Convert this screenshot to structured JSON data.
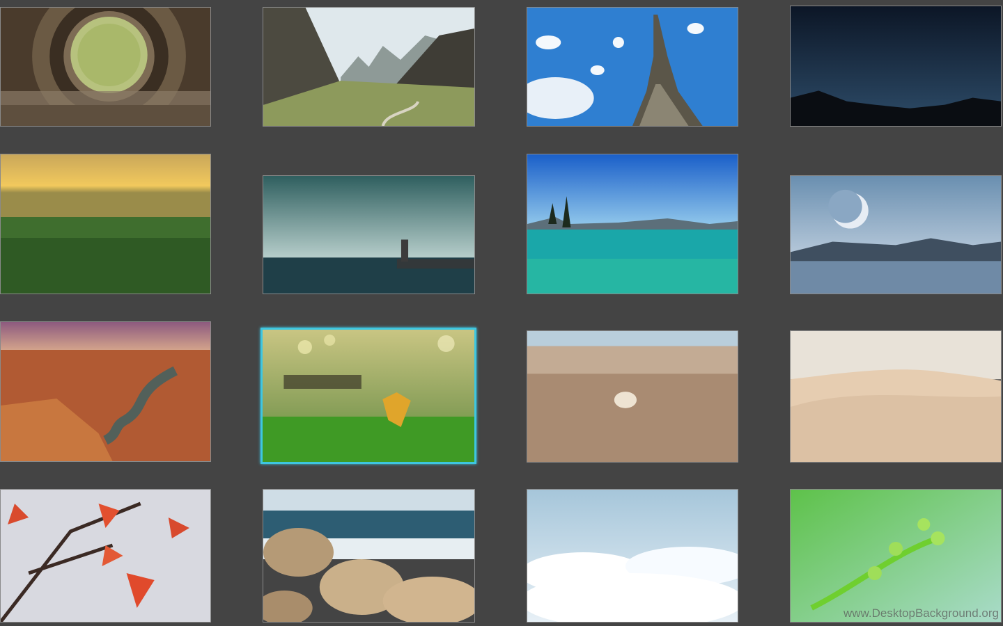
{
  "gallery": {
    "background": "#444444",
    "selection_color": "#3ec6e0",
    "thumbnails": [
      {
        "name": "wooden-tunnel-wallpaper",
        "selected": false
      },
      {
        "name": "mountain-valley-wallpaper",
        "selected": false
      },
      {
        "name": "eiffel-tower-wallpaper",
        "selected": false
      },
      {
        "name": "night-horizon-wallpaper",
        "selected": false
      },
      {
        "name": "wheat-field-sunset-wallpaper",
        "selected": false
      },
      {
        "name": "lighthouse-sea-wallpaper",
        "selected": false
      },
      {
        "name": "turquoise-lake-wallpaper",
        "selected": false
      },
      {
        "name": "moon-lake-wallpaper",
        "selected": false
      },
      {
        "name": "canyon-river-wallpaper",
        "selected": false
      },
      {
        "name": "leaf-on-grass-wallpaper",
        "selected": true
      },
      {
        "name": "seashell-beach-wallpaper",
        "selected": false
      },
      {
        "name": "desert-dunes-wallpaper",
        "selected": false
      },
      {
        "name": "red-maple-leaves-wallpaper",
        "selected": false
      },
      {
        "name": "rocky-shore-wallpaper",
        "selected": false
      },
      {
        "name": "above-clouds-wallpaper",
        "selected": false
      },
      {
        "name": "green-fern-wallpaper",
        "selected": false
      }
    ]
  },
  "watermark": {
    "text": "www.DesktopBackground.org"
  }
}
